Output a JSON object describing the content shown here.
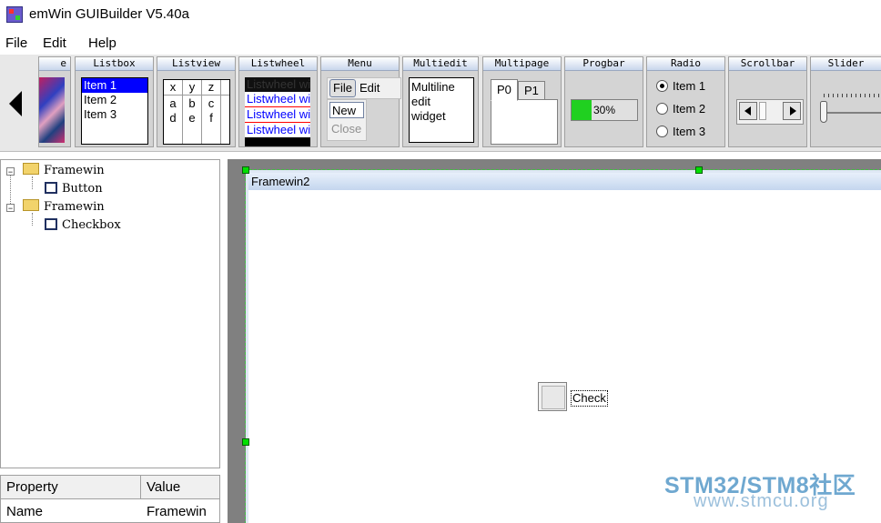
{
  "window": {
    "title": "emWin GUIBuilder V5.40a"
  },
  "menubar": [
    "File",
    "Edit",
    "Help"
  ],
  "palette": {
    "tools": {
      "image": "e",
      "listbox": "Listbox",
      "listview": "Listview",
      "listwheel": "Listwheel",
      "menu": "Menu",
      "multiedit": "Multiedit",
      "multipage": "Multipage",
      "progbar": "Progbar",
      "radio": "Radio",
      "scrollbar": "Scrollbar",
      "slider": "Slider"
    },
    "listbox_items": [
      "Item 1",
      "Item 2",
      "Item 3"
    ],
    "listview_header": [
      "x",
      "y",
      "z"
    ],
    "listview_rows": [
      [
        "a",
        "b",
        "c"
      ],
      [
        "d",
        "e",
        "f"
      ]
    ],
    "listwheel_items": [
      "Listwheel wi",
      "Listwheel wi",
      "Listwheel wi"
    ],
    "menu": {
      "file": "File",
      "edit": "Edit",
      "new": "New",
      "close": "Close"
    },
    "multiedit_lines": [
      "Multiline",
      "edit",
      "widget"
    ],
    "multipage_tabs": [
      "P0",
      "P1"
    ],
    "progbar": {
      "value": 30,
      "text": "30%",
      "fill_color": "#20d020"
    },
    "radio_items": [
      "Item 1",
      "Item 2",
      "Item 3"
    ],
    "radio_selected": 0
  },
  "tree": {
    "nodes": [
      {
        "label": "Framewin",
        "type": "folder",
        "level": 0
      },
      {
        "label": "Button",
        "type": "widget",
        "level": 1
      },
      {
        "label": "Framewin",
        "type": "folder",
        "level": 0
      },
      {
        "label": "Checkbox",
        "type": "widget",
        "level": 1
      }
    ]
  },
  "properties": {
    "headers": {
      "property": "Property",
      "value": "Value"
    },
    "rows": [
      {
        "name": "Name",
        "value": "Framewin"
      }
    ]
  },
  "canvas": {
    "framewin_title": "Framewin2",
    "checkbox_label": "Check",
    "handle_color": "#00e000"
  },
  "watermark": {
    "line1": "STM32/STM8社区",
    "line2": "www.stmcu.org",
    "color": "#6fa8d0"
  }
}
